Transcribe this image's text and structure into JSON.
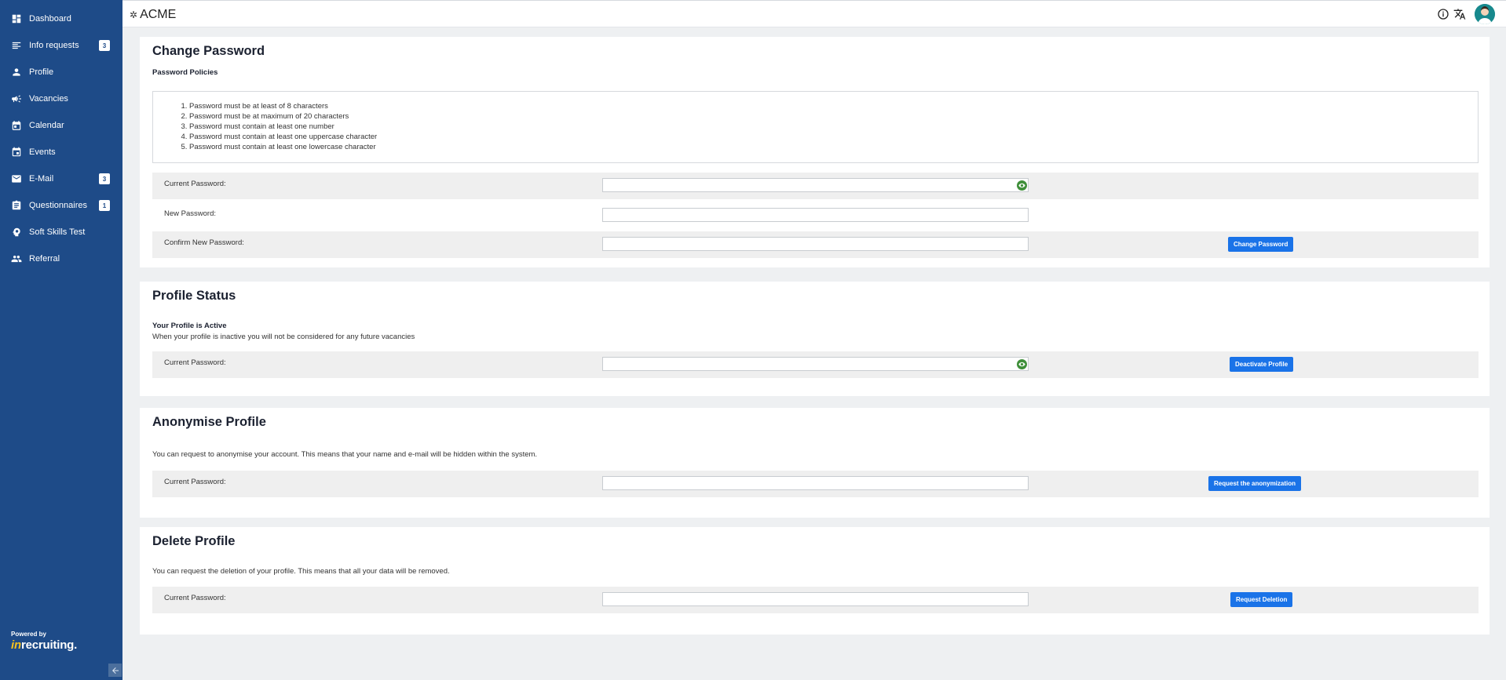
{
  "sidebar": {
    "items": [
      {
        "label": "Dashboard",
        "icon": "dashboard-icon",
        "badge": ""
      },
      {
        "label": "Info requests",
        "icon": "list-icon",
        "badge": "3"
      },
      {
        "label": "Profile",
        "icon": "person-icon",
        "badge": ""
      },
      {
        "label": "Vacancies",
        "icon": "megaphone-icon",
        "badge": ""
      },
      {
        "label": "Calendar",
        "icon": "calendar-icon",
        "badge": ""
      },
      {
        "label": "Events",
        "icon": "event-icon",
        "badge": ""
      },
      {
        "label": "E-Mail",
        "icon": "mail-icon",
        "badge": "3"
      },
      {
        "label": "Questionnaires",
        "icon": "assignment-icon",
        "badge": "1"
      },
      {
        "label": "Soft Skills Test",
        "icon": "psychology-icon",
        "badge": ""
      },
      {
        "label": "Referral",
        "icon": "people-icon",
        "badge": ""
      }
    ],
    "powered_by": "Powered by",
    "brand_mark": "in",
    "brand_name": "recruiting."
  },
  "header": {
    "app_name": "ACME",
    "logo_icon": "✲",
    "info_icon": "info-icon",
    "translate_icon": "translate-icon"
  },
  "change_password": {
    "title": "Change Password",
    "policies_title": "Password Policies",
    "policies": [
      "Password must be at least of 8 characters",
      "Password must be at maximum of 20 characters",
      "Password must contain at least one number",
      "Password must contain at least one uppercase character",
      "Password must contain at least one lowercase character"
    ],
    "current_label": "Current Password:",
    "new_label": "New Password:",
    "confirm_label": "Confirm New Password:",
    "button": "Change Password"
  },
  "profile_status": {
    "title": "Profile Status",
    "status": "Your Profile is Active",
    "description": "When your profile is inactive you will not be considered for any future vacancies",
    "current_label": "Current Password:",
    "button": "Deactivate Profile"
  },
  "anonymise": {
    "title": "Anonymise Profile",
    "description": "You can request to anonymise your account. This means that your name and e-mail will be hidden within the system.",
    "current_label": "Current Password:",
    "button": "Request the anonymization"
  },
  "delete": {
    "title": "Delete Profile",
    "description": "You can request the deletion of your profile. This means that all your data will be removed.",
    "current_label": "Current Password:",
    "button": "Request Deletion"
  },
  "colors": {
    "sidebar": "#1e4b88",
    "primary_button": "#1a73e8",
    "eye_icon": "#3f8f3a"
  }
}
